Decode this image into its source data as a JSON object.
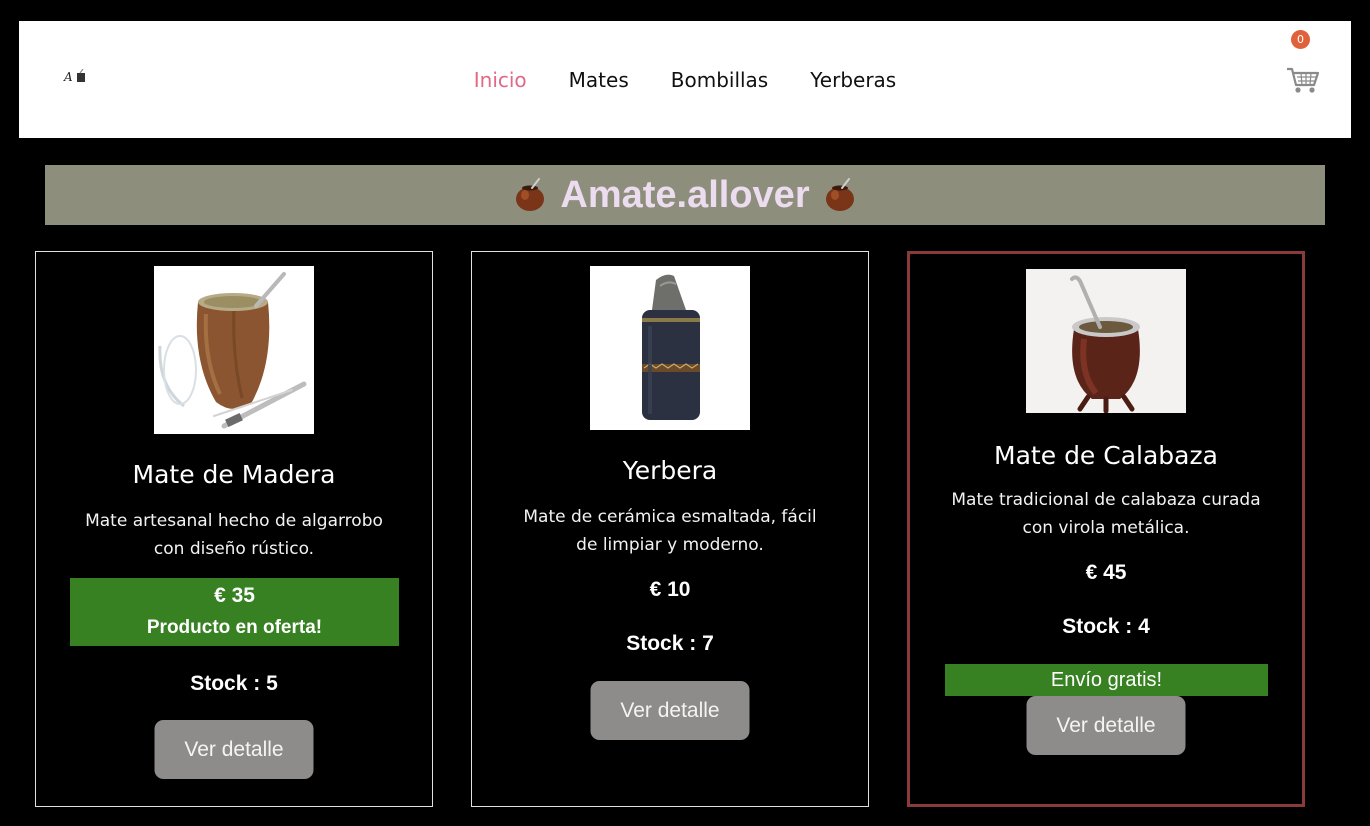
{
  "navbar": {
    "logo_icon": "brand-logo-icon",
    "links": [
      {
        "label": "Inicio",
        "active": true
      },
      {
        "label": "Mates",
        "active": false
      },
      {
        "label": "Bombillas",
        "active": false
      },
      {
        "label": "Yerberas",
        "active": false
      }
    ],
    "cart_icon": "shopping-cart-icon",
    "cart_count": "0"
  },
  "hero": {
    "title": "Amate.allover",
    "icon": "mate-gourd-icon"
  },
  "colors": {
    "active_link": "#e06a86",
    "hero_bg": "#8e8e7c",
    "hero_text": "#ecdcef",
    "offer_green": "#378122",
    "button_gray": "#8e8b8b",
    "featured_border": "#8b3a3a",
    "cart_badge": "#e0623c"
  },
  "products": [
    {
      "title": "Mate de Madera",
      "description": "Mate artesanal hecho de algarrobo con diseño rústico.",
      "price": "€ 35",
      "offer_label": "Producto en oferta!",
      "stock": "Stock : 5",
      "button": "Ver detalle",
      "image_icon": "wooden-mate-image"
    },
    {
      "title": "Yerbera",
      "description": "Mate de cerámica esmaltada, fácil de limpiar y moderno.",
      "price": "€ 10",
      "stock": "Stock : 7",
      "button": "Ver detalle",
      "image_icon": "yerbera-container-image"
    },
    {
      "title": "Mate de Calabaza",
      "description": "Mate tradicional de calabaza curada con virola metálica.",
      "price": "€ 45",
      "stock": "Stock : 4",
      "shipping_label": "Envío gratis!",
      "button": "Ver detalle",
      "image_icon": "gourd-mate-image"
    }
  ]
}
